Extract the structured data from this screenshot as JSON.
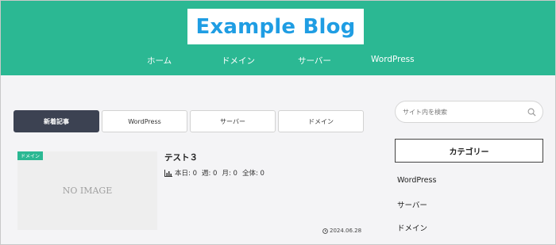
{
  "header": {
    "logo": "Example Blog",
    "nav": [
      "ホーム",
      "ドメイン",
      "サーバー",
      "WordPress"
    ],
    "bg_color": "#2bb893",
    "logo_color": "#1f9de3"
  },
  "tabs": [
    {
      "label": "新着記事",
      "active": true
    },
    {
      "label": "WordPress",
      "active": false
    },
    {
      "label": "サーバー",
      "active": false
    },
    {
      "label": "ドメイン",
      "active": false
    }
  ],
  "post": {
    "badge": "ドメイン",
    "thumbnail_text": "NO IMAGE",
    "title": "テスト３",
    "stats": {
      "today": "本日: 0",
      "week": "週: 0",
      "month": "月: 0",
      "total": "全体: 0"
    },
    "date": "2024.06.28"
  },
  "sidebar": {
    "search_placeholder": "サイト内を検索",
    "category_heading": "カテゴリー",
    "categories": [
      "WordPress",
      "サーバー",
      "ドメイン"
    ]
  },
  "icons": {
    "search": "search-icon",
    "stats": "bar-chart-icon",
    "date": "clock-icon"
  }
}
